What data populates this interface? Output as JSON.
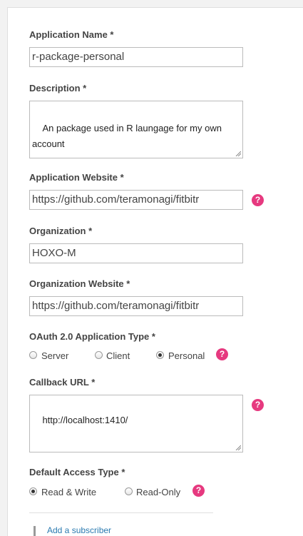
{
  "fields": {
    "app_name": {
      "label": "Application Name",
      "required": "*",
      "value": "r-package-personal"
    },
    "description": {
      "label": "Description",
      "required": "*",
      "value": "An package used in R laungage for my own account"
    },
    "app_website": {
      "label": "Application Website",
      "required": "*",
      "value": "https://github.com/teramonagi/fitbitr"
    },
    "organization": {
      "label": "Organization",
      "required": "*",
      "value": "HOXO-M"
    },
    "org_website": {
      "label": "Organization Website",
      "required": "*",
      "value": "https://github.com/teramonagi/fitbitr"
    },
    "oauth_type": {
      "label": "OAuth 2.0 Application Type",
      "required": "*",
      "options": [
        "Server",
        "Client",
        "Personal"
      ],
      "selected": "Personal"
    },
    "callback_url": {
      "label": "Callback URL",
      "required": "*",
      "value": "http://localhost:1410/"
    },
    "access_type": {
      "label": "Default Access Type",
      "required": "*",
      "options": [
        "Read & Write",
        "Read-Only"
      ],
      "selected": "Read & Write"
    }
  },
  "help_glyph": "?",
  "footer": {
    "add_subscriber": "Add a subscriber"
  },
  "colors": {
    "help": "#e6397f",
    "link": "#2a7ab0"
  }
}
